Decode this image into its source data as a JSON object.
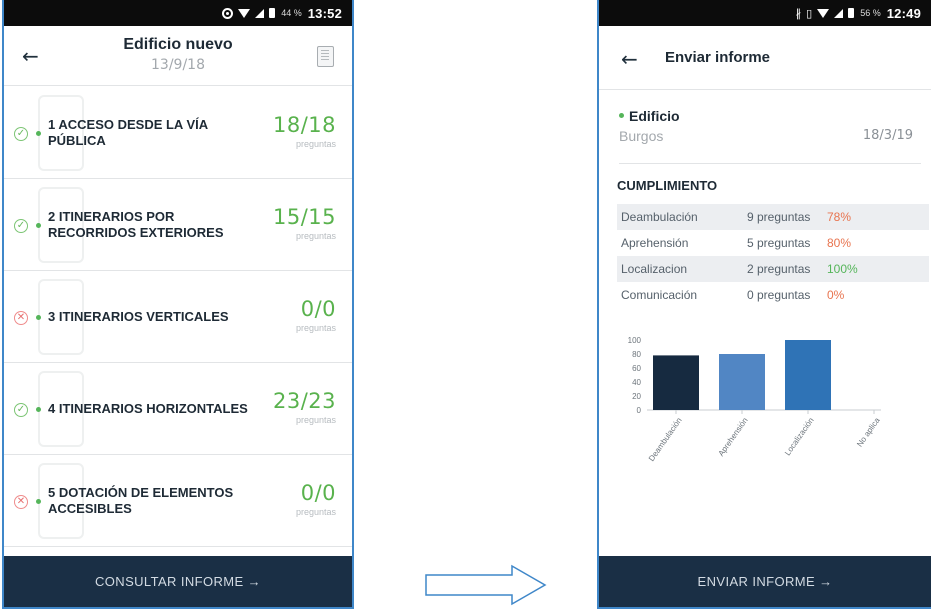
{
  "left_screen": {
    "status_bar": {
      "battery": "44 %",
      "time": "13:52"
    },
    "header": {
      "back_icon": "arrow-left-icon",
      "title": "Edificio nuevo",
      "date": "13/9/18",
      "doc_icon": "report-document-icon"
    },
    "sections": [
      {
        "title": "1 ACCESO DESDE LA VÍA PÚBLICA",
        "score": "18/18",
        "unit": "preguntas",
        "status": "ok",
        "status_symbol": "✓"
      },
      {
        "title": "2 ITINERARIOS POR RECORRIDOS EXTERIORES",
        "score": "15/15",
        "unit": "preguntas",
        "status": "ok",
        "status_symbol": "✓"
      },
      {
        "title": "3 ITINERARIOS VERTICALES",
        "score": "0/0",
        "unit": "preguntas",
        "status": "bad",
        "status_symbol": "✕"
      },
      {
        "title": "4 ITINERARIOS HORIZONTALES",
        "score": "23/23",
        "unit": "preguntas",
        "status": "ok",
        "status_symbol": "✓"
      },
      {
        "title": "5 DOTACIÓN DE ELEMENTOS ACCESIBLES",
        "score": "0/0",
        "unit": "preguntas",
        "status": "bad",
        "status_symbol": "✕"
      }
    ],
    "footer_button": "CONSULTAR INFORME →"
  },
  "right_screen": {
    "status_bar": {
      "battery": "56 %",
      "time": "12:49"
    },
    "header": {
      "back_icon": "arrow-left-icon",
      "title": "Enviar informe"
    },
    "building": {
      "name": "Edificio",
      "city": "Burgos",
      "date": "18/3/19"
    },
    "compliance": {
      "title": "CUMPLIMIENTO",
      "rows": [
        {
          "category": "Deambulación",
          "questions": "9 preguntas",
          "percent": "78%",
          "color": "#e8744f"
        },
        {
          "category": "Aprehensión",
          "questions": "5 preguntas",
          "percent": "80%",
          "color": "#e8744f"
        },
        {
          "category": "Localizacion",
          "questions": "2 preguntas",
          "percent": "100%",
          "color": "#55b55a"
        },
        {
          "category": "Comunicación",
          "questions": "0 preguntas",
          "percent": "0%",
          "color": "#e8744f"
        }
      ]
    },
    "footer_button": "ENVIAR INFORME →"
  },
  "chart_data": {
    "type": "bar",
    "categories": [
      "Deambulación",
      "Aprehensión",
      "Localización",
      "No aplica"
    ],
    "values": [
      78,
      80,
      100,
      0
    ],
    "bar_colors": [
      "#162a40",
      "#5186c4",
      "#2f73b6",
      "#2f73b6"
    ],
    "ylim": [
      0,
      100
    ],
    "yticks": [
      0,
      20,
      40,
      60,
      80,
      100
    ]
  },
  "colors": {
    "accent_green": "#59b24d",
    "footer": "#1a2f45",
    "frame": "#3f87c9"
  }
}
